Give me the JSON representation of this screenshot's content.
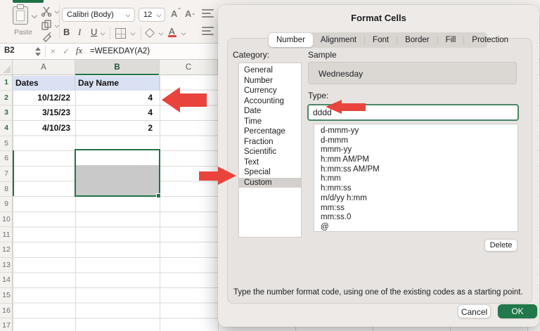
{
  "toolbar": {
    "paste_label": "Paste",
    "font_name": "Calibri (Body)",
    "font_size": "12",
    "bold_label": "B",
    "italic_label": "I",
    "underline_label": "U",
    "grow_font_label": "A",
    "shrink_font_label": "A",
    "font_color_label": "A"
  },
  "formula_bar": {
    "name_box": "B2",
    "cancel_glyph": "×",
    "enter_glyph": "✓",
    "fx_label": "fx",
    "formula": "=WEEKDAY(A2)"
  },
  "sheet": {
    "columns": [
      "A",
      "B",
      "C"
    ],
    "rows": [
      "1",
      "2",
      "3",
      "4",
      "5",
      "6",
      "7",
      "8",
      "9",
      "10",
      "11",
      "12",
      "13",
      "14",
      "15",
      "16",
      "17"
    ],
    "cells": {
      "a1": "Dates",
      "b1": "Day Name",
      "a2": "10/12/22",
      "a3": "3/15/23",
      "a4": "4/10/23",
      "b2": "4",
      "b3": "4",
      "b4": "2"
    }
  },
  "dialog": {
    "title": "Format Cells",
    "tabs": [
      "Number",
      "Alignment",
      "Font",
      "Border",
      "Fill",
      "Protection"
    ],
    "active_tab": "Number",
    "category_label": "Category:",
    "categories": [
      "General",
      "Number",
      "Currency",
      "Accounting",
      "Date",
      "Time",
      "Percentage",
      "Fraction",
      "Scientific",
      "Text",
      "Special",
      "Custom"
    ],
    "selected_category": "Custom",
    "sample_label": "Sample",
    "sample_value": "Wednesday",
    "type_label": "Type:",
    "type_value": "dddd",
    "type_options": [
      "d-mmm-yy",
      "d-mmm",
      "mmm-yy",
      "h:mm AM/PM",
      "h:mm:ss AM/PM",
      "h:mm",
      "h:mm:ss",
      "m/d/yy h:mm",
      "mm:ss",
      "mm:ss.0",
      "@"
    ],
    "delete_label": "Delete",
    "help_text": "Type the number format code, using one of the existing codes as a starting point.",
    "cancel_label": "Cancel",
    "ok_label": "OK"
  },
  "colors": {
    "accent_green": "#217346",
    "arrow_red": "#e8443c",
    "selection_gray": "#c9c9c9",
    "header_fill_blue": "#d9e1f2",
    "ok_button_green": "#21784a"
  }
}
